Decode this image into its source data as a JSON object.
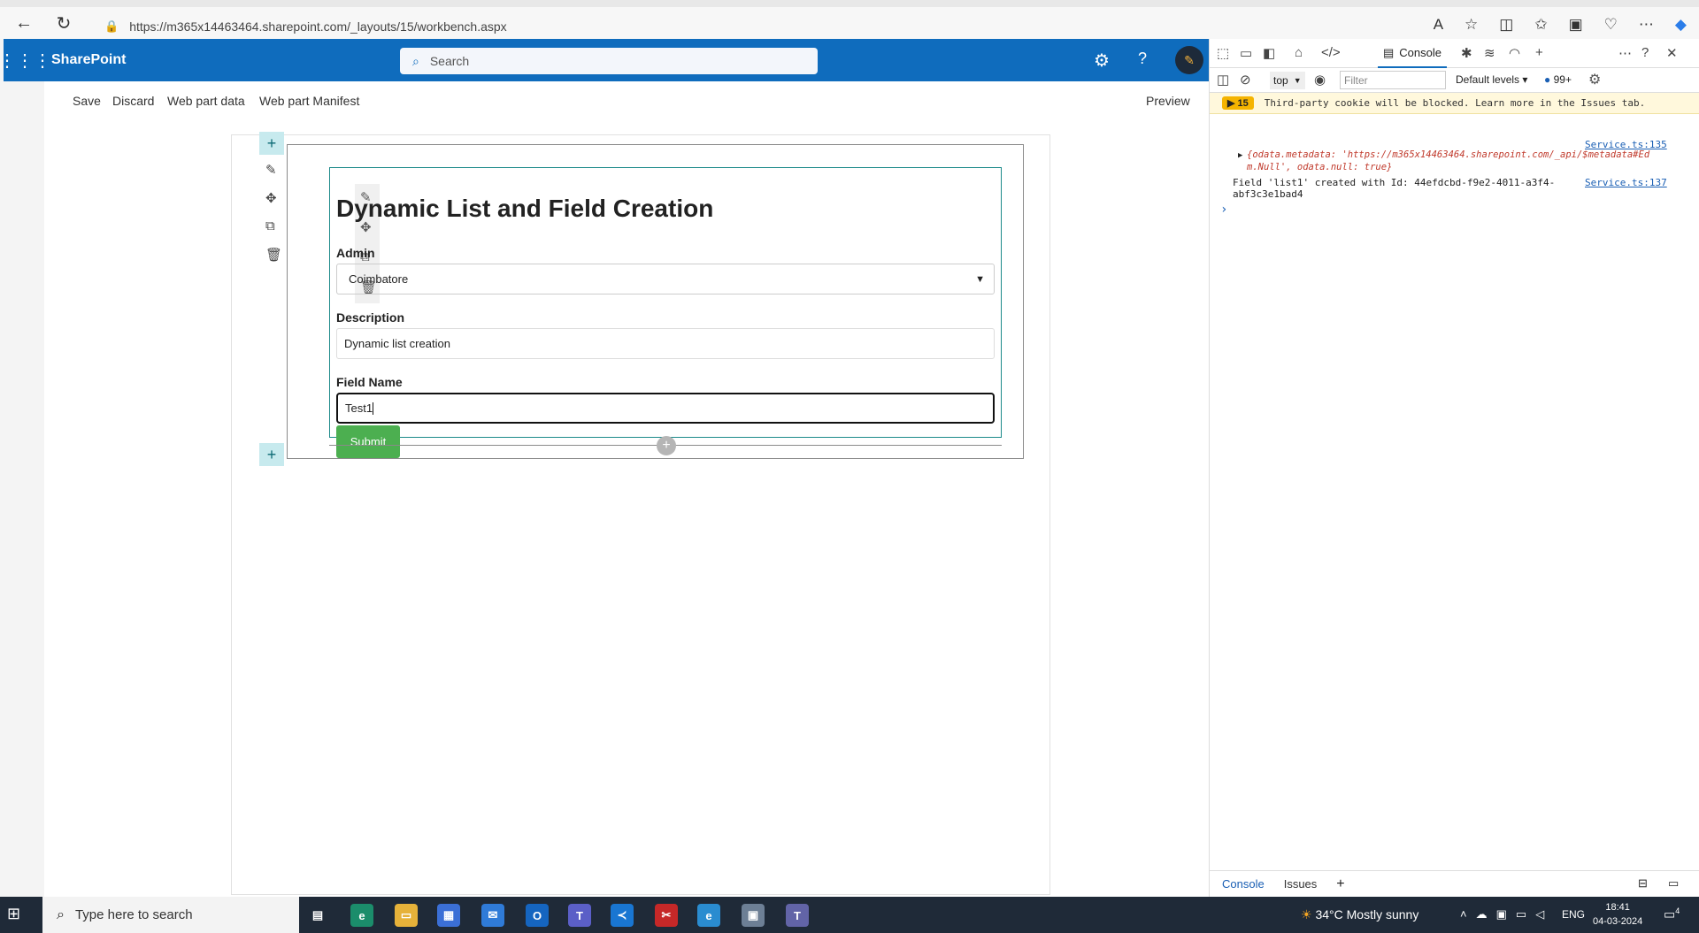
{
  "browser": {
    "url": "https://m365x14463464.sharepoint.com/_layouts/15/workbench.aspx"
  },
  "sharepoint": {
    "title": "SharePoint",
    "search_placeholder": "Search",
    "accent": "#0f6cbd"
  },
  "workbench": {
    "save": "Save",
    "discard": "Discard",
    "web_part_data": "Web part data",
    "web_part_manifest": "Web part Manifest",
    "preview": "Preview"
  },
  "webpart": {
    "title": "Dynamic List and Field Creation",
    "admin_label": "Admin",
    "admin_value": "Coimbatore",
    "description_label": "Description",
    "description_value": "Dynamic list creation",
    "field_name_label": "Field Name",
    "field_name_value": "Test1",
    "submit": "Submit",
    "submit_color": "#4caf50"
  },
  "devtools": {
    "console_tab": "Console",
    "context": "top",
    "filter_placeholder": "Filter",
    "levels": "Default levels",
    "message_count": "99+",
    "warning_count": "15",
    "warning_text": "Third-party cookie will be blocked. Learn more in the Issues tab.",
    "log1_source": "Service.ts:135",
    "log1_line1": "{odata.metadata: 'https://m365x14463464.sharepoint.com/_api/$metadata#Ed",
    "log1_line2": "m.Null', odata.null: true}",
    "log2_source": "Service.ts:137",
    "log2_line1": "Field 'list1' created with Id: 44efdcbd-f9e2-4011-a3f4-",
    "log2_line2": "abf3c3e1bad4",
    "bottom_console": "Console",
    "bottom_issues": "Issues"
  },
  "taskbar": {
    "search_placeholder": "Type here to search",
    "weather": "34°C  Mostly sunny",
    "language": "ENG",
    "time": "18:41",
    "date": "04-03-2024",
    "notifications": "4"
  }
}
